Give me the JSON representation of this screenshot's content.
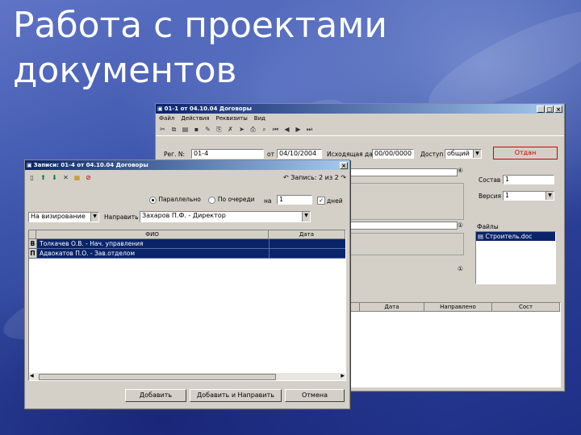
{
  "slide": {
    "title": "Работа с проектами документов"
  },
  "back_window": {
    "title": "01-1 от 04.10.04 Договоры",
    "menu": [
      "Файл",
      "Действия",
      "Реквизиты",
      "Вид"
    ],
    "reg_no_label": "Рег. N:",
    "reg_no_value": "01-4",
    "date_from_label": "от",
    "date_from_value": "04/10/2004",
    "incoming_date_label": "Исходящая дата",
    "incoming_date_value": "00/00/0000",
    "access_label": "Доступ",
    "access_value": "общий",
    "status_button": "Отдан",
    "sostav_label": "Состав",
    "sostav_value": "1",
    "version_label": "Версия",
    "version_value": "1",
    "files_label": "Файлы",
    "file_name": "Строитель.doc",
    "columns": [
      "Дата",
      "Направлено",
      "Сост"
    ],
    "marker1": "④",
    "marker2": "①",
    "marker3": "①"
  },
  "front_window": {
    "title": "Записи: 01-4 от 04.10.04 Договоры",
    "record_info": "Запись: 2 из 2",
    "radio_parallel": "Параллельно",
    "radio_sequential": "По очереди",
    "term_label": "на",
    "term_value": "1",
    "days_label": "дней",
    "purpose_value": "На визирование",
    "direct_label": "Направить",
    "direct_value": "Захаров П.Ф. - Директор",
    "columns": [
      "ФИО",
      "Дата"
    ],
    "rows": [
      {
        "mark": "В",
        "name": "Толкачев О.В. - Нач. управления",
        "date": ""
      },
      {
        "mark": "П",
        "name": "Адвокатов П.О. - Зав.отделом",
        "date": ""
      }
    ],
    "buttons": [
      "Добавить",
      "Добавить и Направить",
      "Отмена"
    ]
  }
}
